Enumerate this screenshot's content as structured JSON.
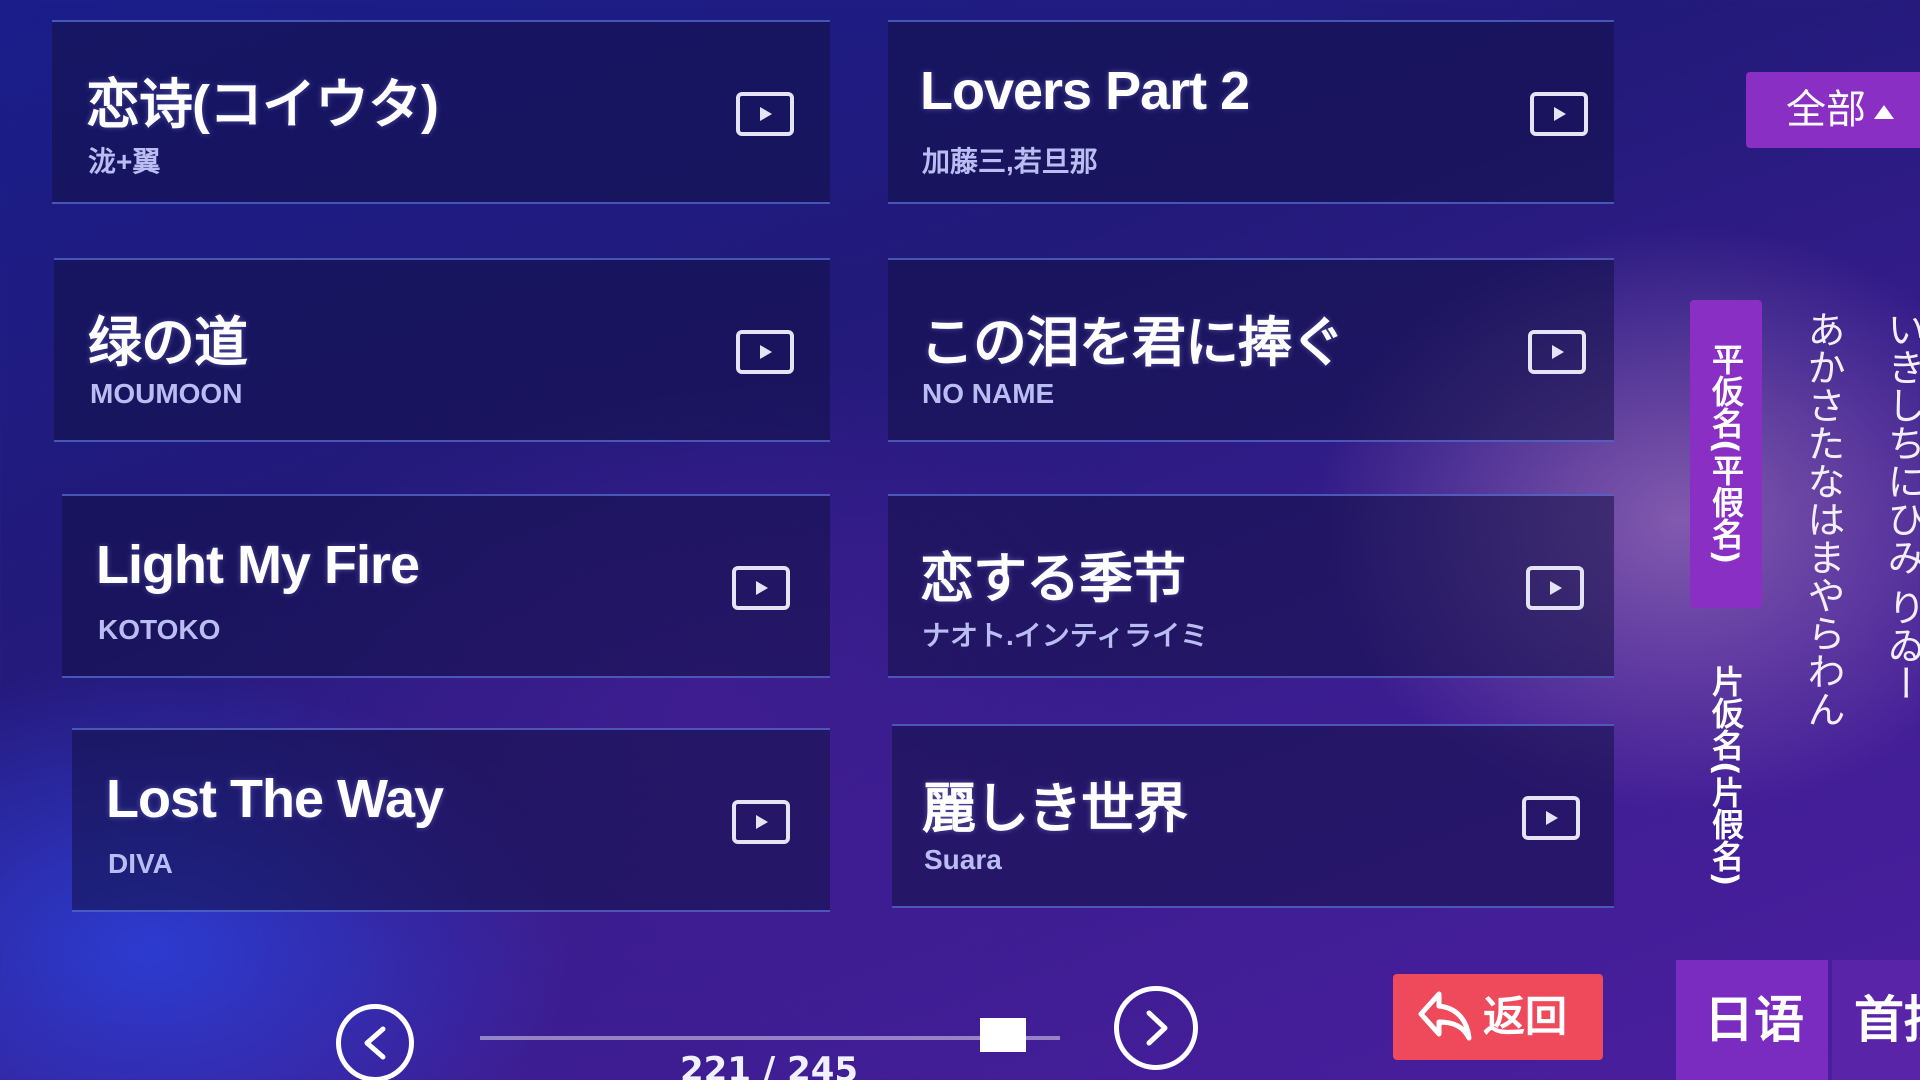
{
  "songs": [
    {
      "title": "恋诗(コイウタ)",
      "artist": "泷+翼"
    },
    {
      "title": "Lovers Part 2",
      "artist": "加藤三,若旦那"
    },
    {
      "title": "绿の道",
      "artist": "MOUMOON"
    },
    {
      "title": "この泪を君に捧ぐ",
      "artist": "NO NAME"
    },
    {
      "title": "Light My Fire",
      "artist": "KOTOKO"
    },
    {
      "title": "恋する季节",
      "artist": "ナオト.インティライミ"
    },
    {
      "title": "Lost The Way",
      "artist": "DIVA"
    },
    {
      "title": "麗しき世界",
      "artist": "Suara"
    }
  ],
  "filter": {
    "label": "全部"
  },
  "kana_panel": {
    "tabs": [
      "平仮名(平假名)",
      "片仮名(片假名)"
    ],
    "columns": [
      "あかさたなはまやらわん",
      "いきしちにひみ りゐー"
    ]
  },
  "pagination": {
    "current_text": "221 / 245"
  },
  "back_button": {
    "label": "返回"
  },
  "language_tabs": [
    "日语",
    "首拼"
  ],
  "colors": {
    "accent_purple": "#8a2fc4",
    "back_red": "#ee4a5c"
  }
}
